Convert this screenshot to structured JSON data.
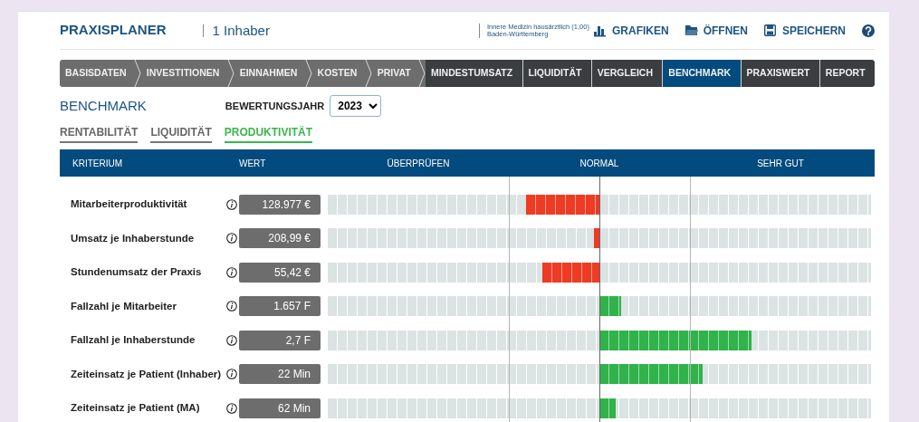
{
  "header": {
    "title": "PRAXISPLANER",
    "subtitle": "1 Inhaber",
    "specialty": "Innere Medizin hausärztlich (1,00)",
    "region": "Baden-Württemberg",
    "actions": [
      {
        "label": "GRAFIKEN",
        "kind": "charts"
      },
      {
        "label": "ÖFFNEN",
        "kind": "open"
      },
      {
        "label": "SPEICHERN",
        "kind": "save"
      }
    ]
  },
  "tabs": [
    {
      "label": "BASISDATEN",
      "kind": "step",
      "selected": false
    },
    {
      "label": "INVESTITIONEN",
      "kind": "step",
      "selected": false
    },
    {
      "label": "EINNAHMEN",
      "kind": "step",
      "selected": false
    },
    {
      "label": "KOSTEN",
      "kind": "step",
      "selected": false
    },
    {
      "label": "PRIVAT",
      "kind": "step",
      "selected": false
    },
    {
      "label": "MINDESTUMSATZ",
      "kind": "page",
      "selected": false
    },
    {
      "label": "LIQUIDITÄT",
      "kind": "page",
      "selected": false
    },
    {
      "label": "VERGLEICH",
      "kind": "page",
      "selected": false
    },
    {
      "label": "BENCHMARK",
      "kind": "page",
      "selected": true
    },
    {
      "label": "PRAXISWERT",
      "kind": "page",
      "selected": false
    },
    {
      "label": "REPORT",
      "kind": "page",
      "selected": false
    }
  ],
  "section": {
    "title": "BENCHMARK",
    "year_label": "BEWERTUNGSJAHR",
    "year": "2023"
  },
  "subtabs": [
    {
      "label": "RENTABILITÄT",
      "selected": false
    },
    {
      "label": "LIQUIDITÄT",
      "selected": false
    },
    {
      "label": "PRODUKTIVITÄT",
      "selected": true
    }
  ],
  "table": {
    "columns": [
      "KRITERIUM",
      "WERT"
    ],
    "scale": [
      "ÜBERPRÜFEN",
      "NORMAL",
      "SEHR GUT"
    ],
    "rows": [
      {
        "label": "Mitarbeiterproduktivität",
        "value": "128.977 €",
        "kind": "below",
        "level": 0.27
      },
      {
        "label": "Umsatz je Inhaberstunde",
        "value": "208,99 €",
        "kind": "below",
        "level": 0.02
      },
      {
        "label": "Stundenumsatz der Praxis",
        "value": "55,42 €",
        "kind": "below",
        "level": 0.21
      },
      {
        "label": "Fallzahl je Mitarbeiter",
        "value": "1.657 F",
        "kind": "above",
        "level": 0.08
      },
      {
        "label": "Fallzahl je Inhaberstunde",
        "value": "2,7 F",
        "kind": "above",
        "level": 0.56
      },
      {
        "label": "Zeiteinsatz je Patient (Inhaber)",
        "value": "22 Min",
        "kind": "above",
        "level": 0.38
      },
      {
        "label": "Zeiteinsatz je Patient (MA)",
        "value": "62 Min",
        "kind": "above",
        "level": 0.06
      }
    ]
  }
}
